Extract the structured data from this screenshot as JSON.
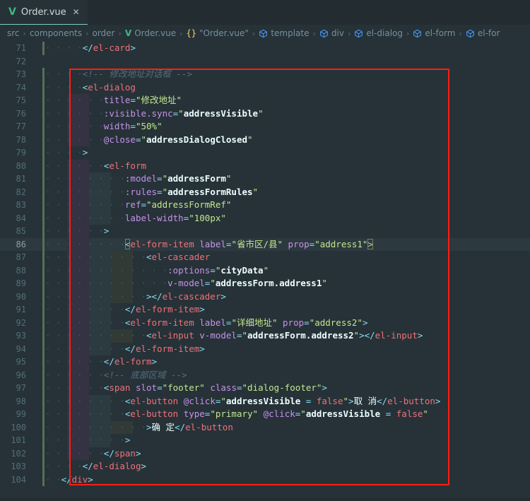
{
  "window": {
    "accent_color": "#80cbc4",
    "background": "#263238"
  },
  "tab": {
    "icon": "vue-file-icon",
    "icon_glyph": "V",
    "label": "Order.vue",
    "close_glyph": "✕"
  },
  "breadcrumb": {
    "items": [
      {
        "label": "src",
        "icon": "none"
      },
      {
        "label": "components",
        "icon": "none"
      },
      {
        "label": "order",
        "icon": "none"
      },
      {
        "label": "Order.vue",
        "icon": "vue-file-icon"
      },
      {
        "label": "\"Order.vue\"",
        "icon": "braces-icon"
      },
      {
        "label": "template",
        "icon": "cube-symbol-icon"
      },
      {
        "label": "div",
        "icon": "cube-symbol-icon"
      },
      {
        "label": "el-dialog",
        "icon": "cube-symbol-icon"
      },
      {
        "label": "el-form",
        "icon": "cube-symbol-icon"
      },
      {
        "label": "el-for",
        "icon": "cube-symbol-icon"
      }
    ],
    "separator": "›"
  },
  "annotation": {
    "type": "rectangle-highlight",
    "color": "#ff1d12",
    "encloses_lines": "73-103"
  },
  "editor": {
    "language": "vue",
    "cursor_line": 86,
    "first_line": 71,
    "last_line": 104,
    "lines": [
      {
        "n": 71,
        "text": "    </el-card>"
      },
      {
        "n": 72,
        "text": ""
      },
      {
        "n": 73,
        "text": "    <!-- 修改地址对话框 -->"
      },
      {
        "n": 74,
        "text": "    <el-dialog"
      },
      {
        "n": 75,
        "text": "      title=\"修改地址\""
      },
      {
        "n": 76,
        "text": "      :visible.sync=\"addressVisible\""
      },
      {
        "n": 77,
        "text": "      width=\"50%\""
      },
      {
        "n": 78,
        "text": "      @close=\"addressDialogClosed\""
      },
      {
        "n": 79,
        "text": "    >"
      },
      {
        "n": 80,
        "text": "      <el-form"
      },
      {
        "n": 81,
        "text": "        :model=\"addressForm\""
      },
      {
        "n": 82,
        "text": "        :rules=\"addressFormRules\""
      },
      {
        "n": 83,
        "text": "        ref=\"addressFormRef\""
      },
      {
        "n": 84,
        "text": "        label-width=\"100px\""
      },
      {
        "n": 85,
        "text": "      >"
      },
      {
        "n": 86,
        "text": "        <el-form-item label=\"省市区/县\" prop=\"address1\">"
      },
      {
        "n": 87,
        "text": "          <el-cascader"
      },
      {
        "n": 88,
        "text": "            :options=\"cityData\""
      },
      {
        "n": 89,
        "text": "            v-model=\"addressForm.address1\""
      },
      {
        "n": 90,
        "text": "          ></el-cascader>"
      },
      {
        "n": 91,
        "text": "        </el-form-item>"
      },
      {
        "n": 92,
        "text": "        <el-form-item label=\"详细地址\" prop=\"address2\">"
      },
      {
        "n": 93,
        "text": "          <el-input v-model=\"addressForm.address2\"></el-input>"
      },
      {
        "n": 94,
        "text": "        </el-form-item>"
      },
      {
        "n": 95,
        "text": "      </el-form>"
      },
      {
        "n": 96,
        "text": "      <!-- 底部区域 -->"
      },
      {
        "n": 97,
        "text": "      <span slot=\"footer\" class=\"dialog-footer\">"
      },
      {
        "n": 98,
        "text": "        <el-button @click=\"addressVisible = false\">取 消</el-button>"
      },
      {
        "n": 99,
        "text": "        <el-button type=\"primary\" @click=\"addressVisible = false\""
      },
      {
        "n": 100,
        "text": "          >确 定</el-button"
      },
      {
        "n": 101,
        "text": "        >"
      },
      {
        "n": 102,
        "text": "      </span>"
      },
      {
        "n": 103,
        "text": "    </el-dialog>"
      },
      {
        "n": 104,
        "text": "  </div>"
      }
    ],
    "line_numbers": [
      71,
      72,
      73,
      74,
      75,
      76,
      77,
      78,
      79,
      80,
      81,
      82,
      83,
      84,
      85,
      86,
      87,
      88,
      89,
      90,
      91,
      92,
      93,
      94,
      95,
      96,
      97,
      98,
      99,
      100,
      101,
      102,
      103,
      104
    ]
  },
  "tokens": {
    "comment_color": "#546e7a",
    "tag_color": "#f07178",
    "attribute_color": "#c792ea",
    "string_color": "#c3e88d",
    "expression_color": "#eeffff",
    "punctuation_color": "#89ddf3"
  }
}
